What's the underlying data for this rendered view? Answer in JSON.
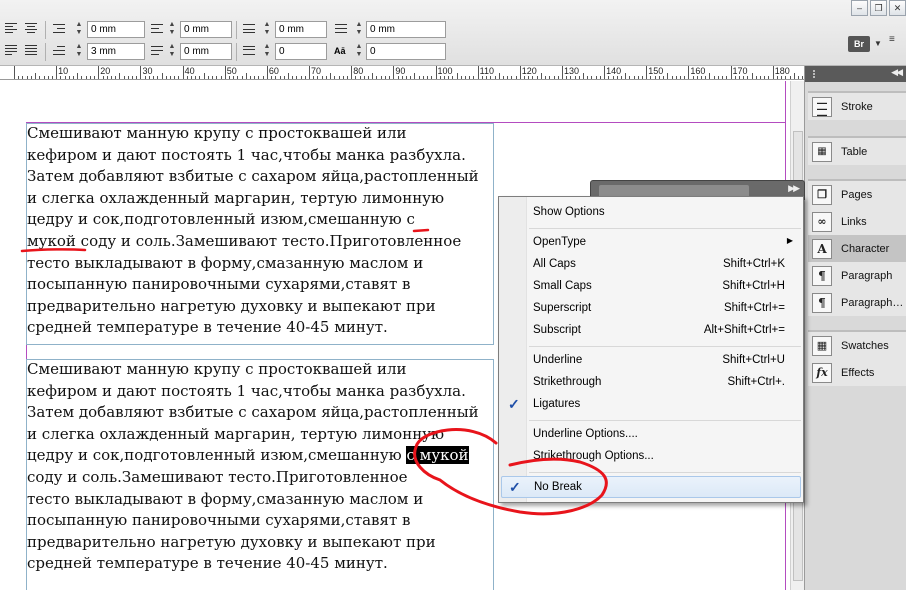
{
  "toolbar": {
    "fields": [
      "0 mm",
      "0 mm",
      "0 mm",
      "0 mm",
      "3 mm",
      "0 mm",
      "0",
      "0"
    ],
    "window_buttons": [
      "–",
      "❐",
      "✕"
    ],
    "bridge_label": "Br"
  },
  "ruler": {
    "labels": [
      "10",
      "20",
      "30",
      "40",
      "50",
      "60",
      "70",
      "80",
      "90",
      "100",
      "110",
      "120",
      "130",
      "140",
      "150",
      "160",
      "170",
      "180",
      "19"
    ]
  },
  "document": {
    "block1": [
      "   Смешивают манную крупу с простоквашей или",
      "кефиром и дают постоять 1 час,чтобы манка разбухла.",
      "Затем добавляют взбитые с сахаром яйца,растопленный",
      "и слегка охлажденный маргарин, тертую лимонную",
      "цедру и сок,подготовленный изюм,смешанную с",
      "мукой соду и соль.Замешивают тесто.Приготовленное",
      "тесто выкладывают в форму,смазанную маслом и",
      "посыпанную панировочными сухарями,ставят в",
      "предварительно нагретую духовку и выпекают при",
      "средней температуре в течение 40-45 минут."
    ],
    "block2": [
      "   Смешивают манную крупу с простоквашей или",
      "кефиром и дают постоять 1 час,чтобы манка разбухла.",
      "Затем добавляют взбитые с сахаром яйца,растопленный",
      "и слегка охлажденный маргарин, тертую лимонную",
      "цедру и сок,подготовленный изюм,смешанную ",
      "с мукой",
      "соду и соль.Замешивают тесто.Приготовленное",
      "тесто выкладывают в форму,смазанную маслом и",
      "посыпанную панировочными сухарями,ставят в",
      "предварительно нагретую духовку и выпекают при",
      "средней температуре в течение 40-45 минут."
    ]
  },
  "panels": {
    "items": [
      {
        "label": "Stroke",
        "icon": "stroke-icon"
      },
      {
        "label": "Table",
        "icon": "table-icon"
      },
      {
        "label": "Pages",
        "icon": "pages-icon"
      },
      {
        "label": "Links",
        "icon": "links-icon"
      },
      {
        "label": "Character",
        "icon": "character-icon",
        "active": true
      },
      {
        "label": "Paragraph",
        "icon": "paragraph-icon"
      },
      {
        "label": "Paragraph…",
        "icon": "paragraph-styles-icon"
      },
      {
        "label": "Swatches",
        "icon": "swatches-icon"
      },
      {
        "label": "Effects",
        "icon": "effects-icon"
      }
    ]
  },
  "menu": {
    "items": [
      {
        "label": "Show Options",
        "shortcut": ""
      },
      {
        "label": "OpenType",
        "shortcut": "",
        "submenu": true
      },
      {
        "label": "All Caps",
        "shortcut": "Shift+Ctrl+K"
      },
      {
        "label": "Small Caps",
        "shortcut": "Shift+Ctrl+H"
      },
      {
        "label": "Superscript",
        "shortcut": "Shift+Ctrl+="
      },
      {
        "label": "Subscript",
        "shortcut": "Alt+Shift+Ctrl+="
      },
      {
        "label": "Underline",
        "shortcut": "Shift+Ctrl+U"
      },
      {
        "label": "Strikethrough",
        "shortcut": "Shift+Ctrl+."
      },
      {
        "label": "Ligatures",
        "shortcut": "",
        "checked": true
      },
      {
        "label": "Underline Options....",
        "shortcut": ""
      },
      {
        "label": "Strikethrough Options...",
        "shortcut": ""
      },
      {
        "label": "No Break",
        "shortcut": "",
        "checked": true,
        "highlighted": true
      }
    ]
  },
  "colors": {
    "annotation": "#e8141b",
    "margin_guide": "#b44cc0",
    "frame_edge": "#8fb2c9",
    "check": "#1f4fa8"
  }
}
